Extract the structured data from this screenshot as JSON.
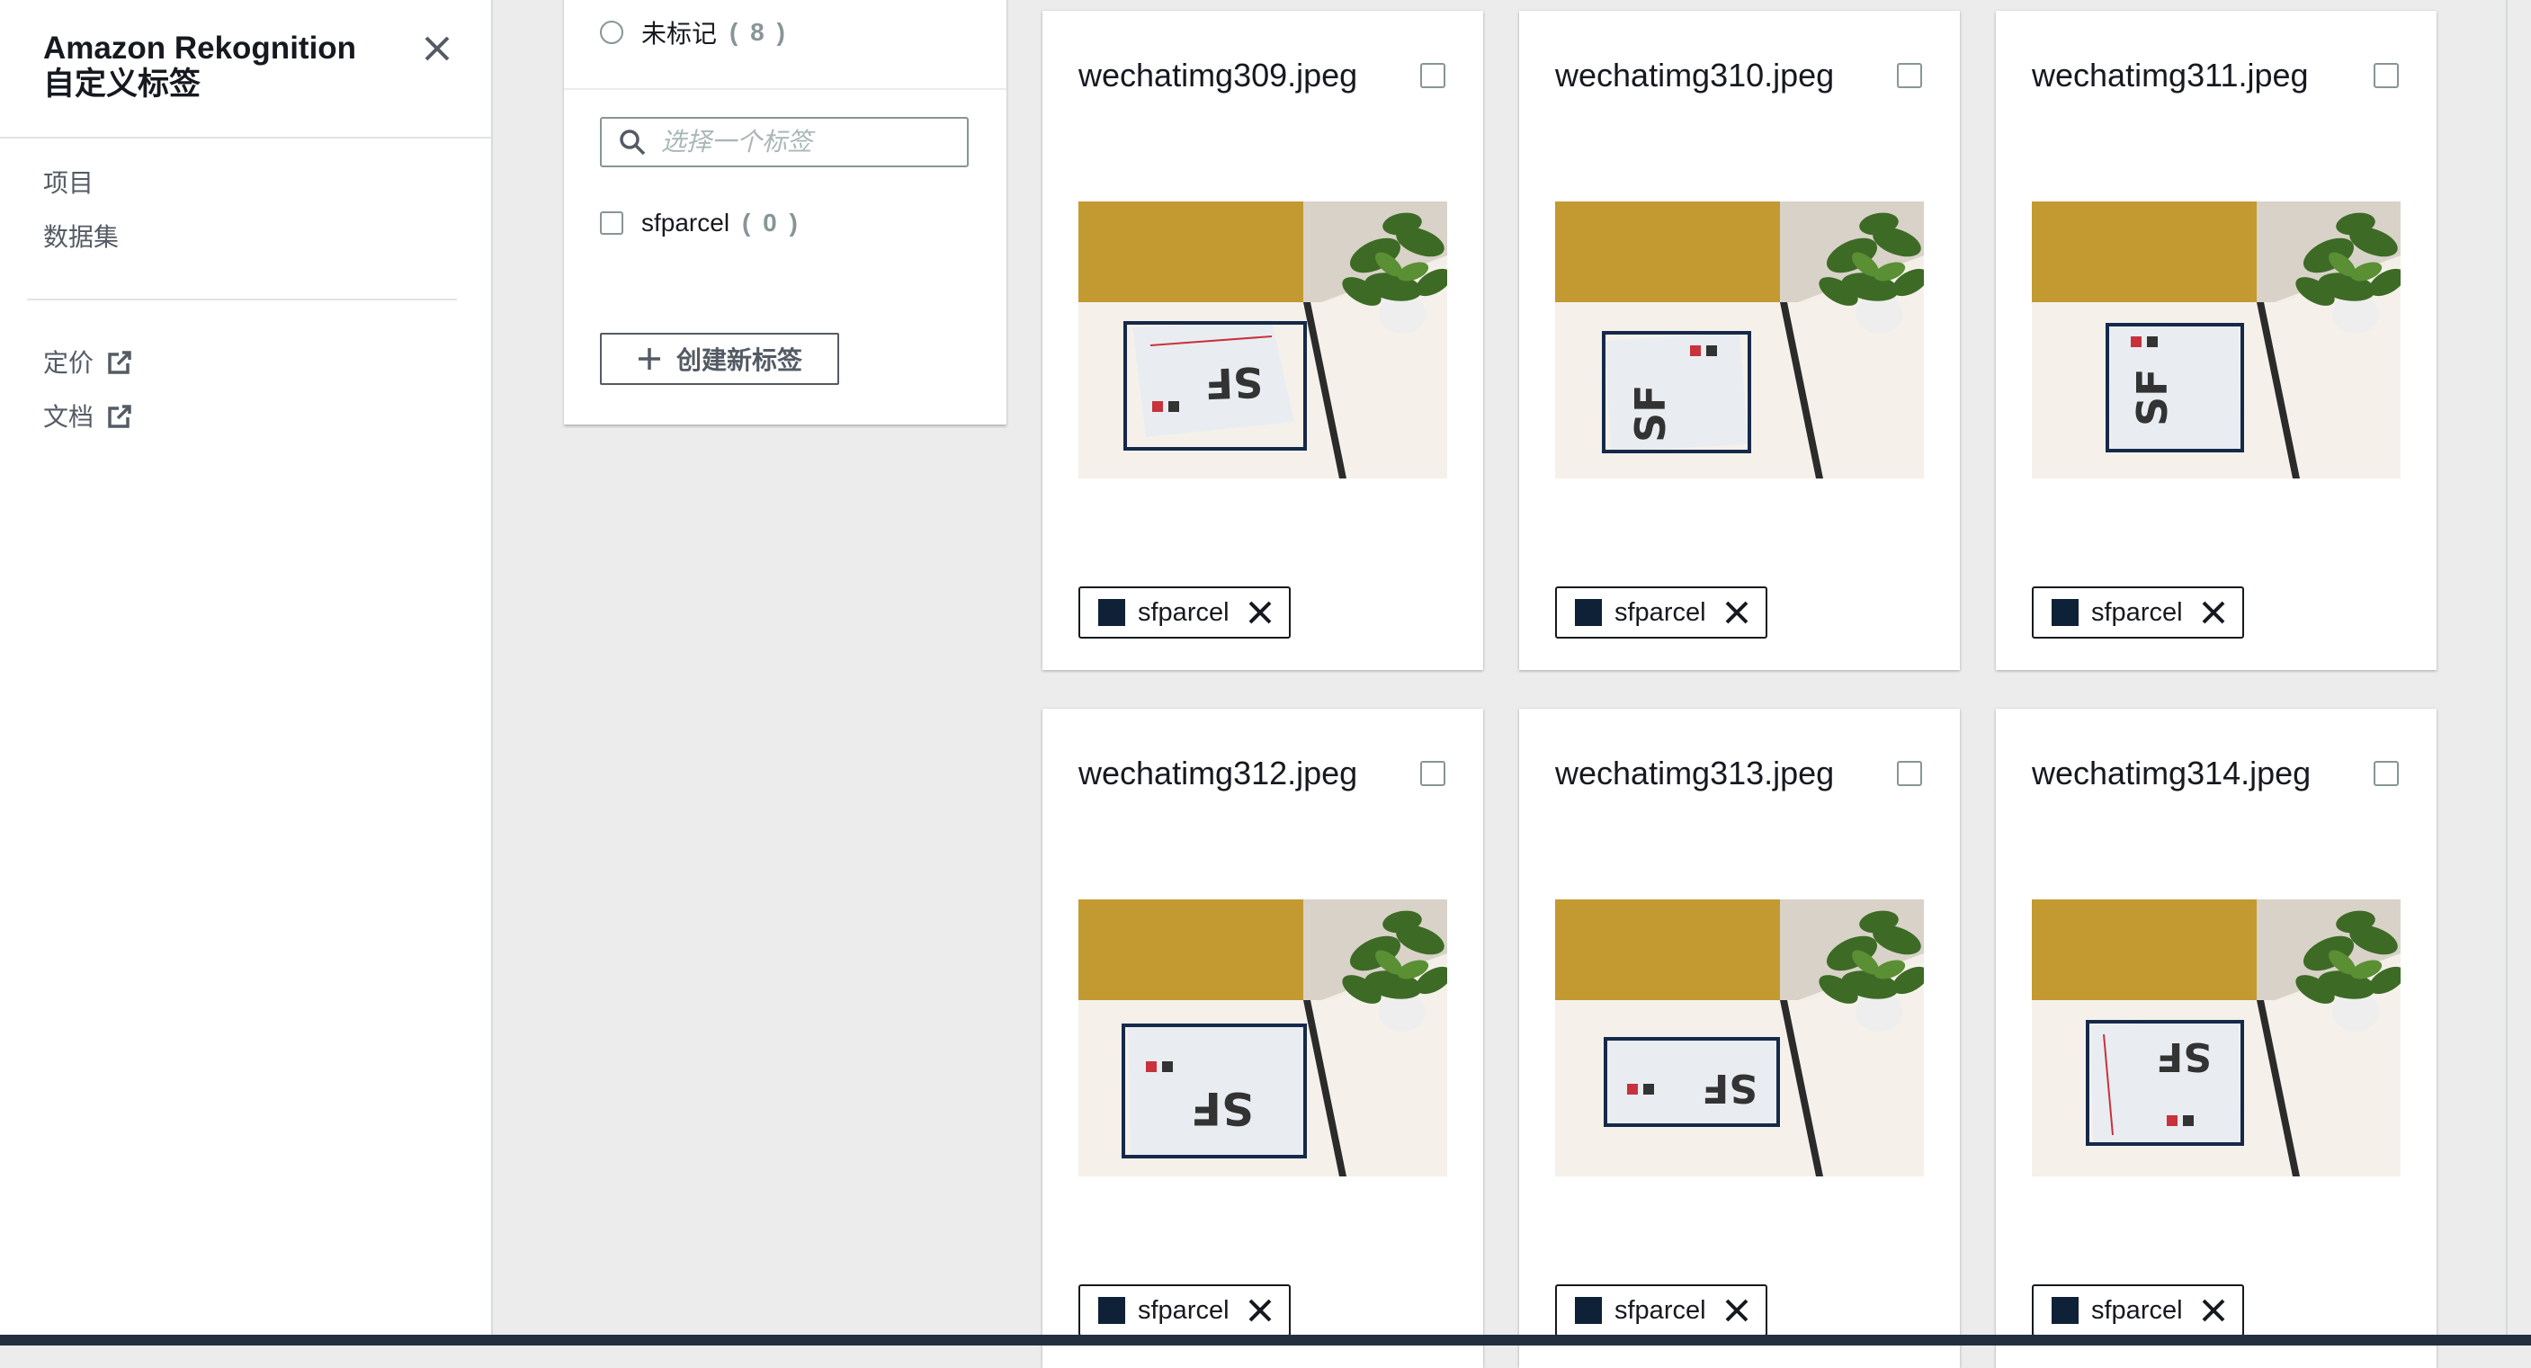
{
  "nav": {
    "title_line1": "Amazon Rekognition",
    "title_line2": "自定义标签",
    "items": [
      {
        "label": "项目"
      },
      {
        "label": "数据集"
      }
    ],
    "ext_links": [
      {
        "label": "定价"
      },
      {
        "label": "文档"
      }
    ]
  },
  "filter": {
    "unlabeled": {
      "label": "未标记",
      "count": "( 8 )"
    },
    "search_placeholder": "选择一个标签",
    "labels": [
      {
        "label": "sfparcel",
        "count": "( 0 )"
      }
    ],
    "create_button": "创建新标签"
  },
  "cards": [
    {
      "filename": "wechatimg309.jpeg",
      "tag": "sfparcel"
    },
    {
      "filename": "wechatimg310.jpeg",
      "tag": "sfparcel"
    },
    {
      "filename": "wechatimg311.jpeg",
      "tag": "sfparcel"
    },
    {
      "filename": "wechatimg312.jpeg",
      "tag": "sfparcel"
    },
    {
      "filename": "wechatimg313.jpeg",
      "tag": "sfparcel"
    },
    {
      "filename": "wechatimg314.jpeg",
      "tag": "sfparcel"
    }
  ],
  "colors": {
    "tag_swatch": "#0f2137",
    "page_bg": "#ececec",
    "nav_bg": "#ffffff"
  }
}
